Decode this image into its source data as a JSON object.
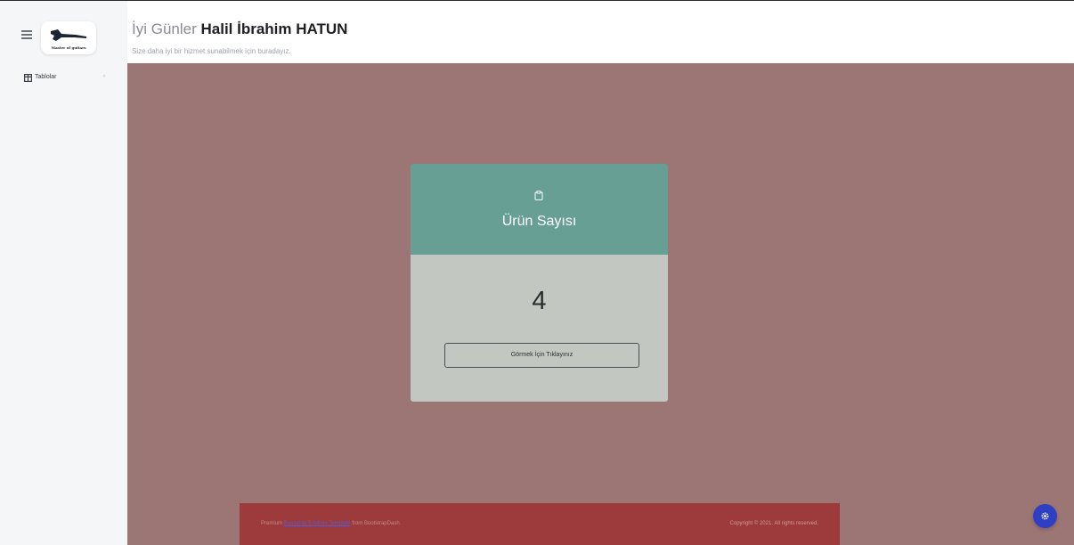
{
  "sidebar": {
    "logo_text": "Master of guitars",
    "items": [
      {
        "label": "Tablolar",
        "icon": "table-icon"
      }
    ]
  },
  "header": {
    "greeting": "İyi Günler",
    "user_name": "Halil İbrahim HATUN",
    "subtitle": "Size daha iyi bir hizmet sunabilmek için buradayız."
  },
  "card": {
    "icon": "clipboard-icon",
    "title": "Ürün Sayısı",
    "count": "4",
    "button_label": "Görmek İçin Tıklayınız",
    "header_color": "#679f95",
    "body_color": "#c2c7c1"
  },
  "footer": {
    "left_prefix": "Premium",
    "left_link": "Bootstrap 5 Admin Template",
    "left_suffix": "from BootstrapDash.",
    "right_text": "Copyright © 2021. All rights reserved."
  },
  "settings_button": {
    "icon": "gear-icon",
    "color": "#2f3fc4"
  },
  "colors": {
    "main_background": "#9c7674",
    "footer_background": "#9c3a3c",
    "sidebar_background": "#f5f6f8"
  }
}
